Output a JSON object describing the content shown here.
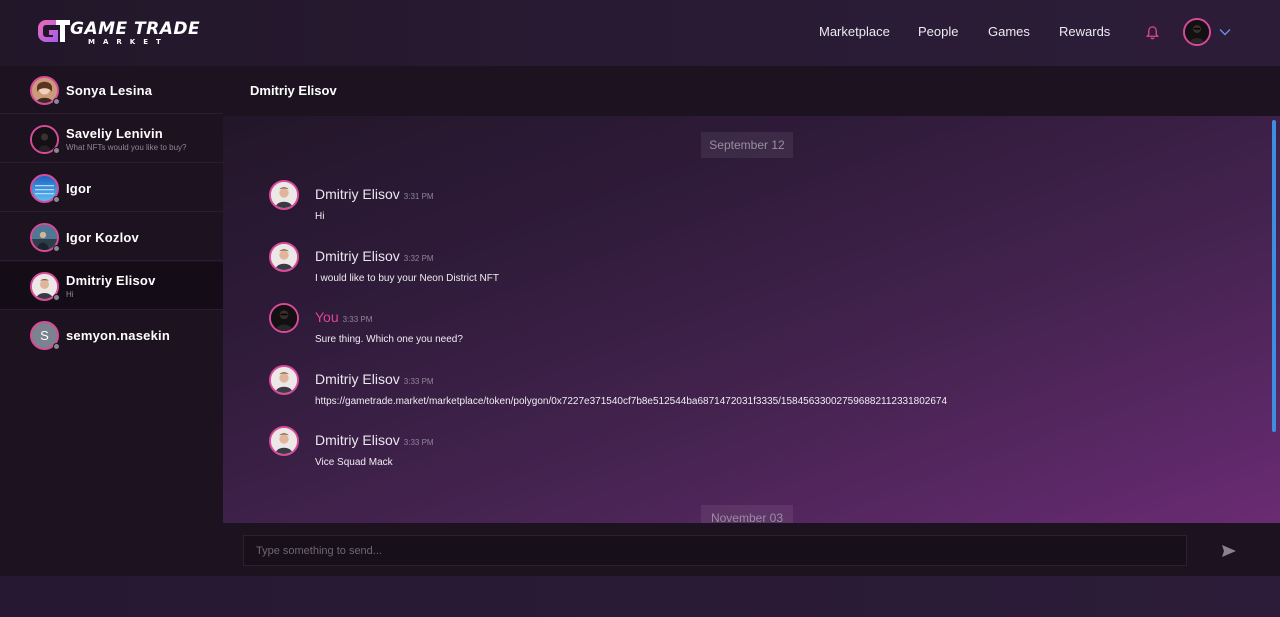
{
  "app": {
    "logo_main": "GAME TRADE",
    "logo_sub": "MARKET"
  },
  "nav": {
    "items": [
      "Marketplace",
      "People",
      "Games",
      "Rewards"
    ],
    "icons": {
      "bell": "bell-icon",
      "chevron": "chevron-down-icon"
    }
  },
  "colors": {
    "accent": "#d94a98",
    "you_name": "#e0449a",
    "scrollbar": "#3c8fe0",
    "sidebar_bg": "#1c1220"
  },
  "sidebar": {
    "contacts": [
      {
        "name": "Sonya Lesina",
        "preview": ""
      },
      {
        "name": "Saveliy Lenivin",
        "preview": "What NFTs would you like to buy?"
      },
      {
        "name": "Igor",
        "preview": ""
      },
      {
        "name": "Igor Kozlov",
        "preview": ""
      },
      {
        "name": "Dmitriy Elisov",
        "preview": "Hi",
        "active": true
      },
      {
        "name": "semyon.nasekin",
        "preview": "",
        "initial": "S"
      }
    ]
  },
  "chat": {
    "title": "Dmitriy Elisov",
    "dates": [
      "September 12",
      "November 03"
    ],
    "messages": [
      {
        "author": "Dmitriy Elisov",
        "time": "3:31 PM",
        "text": "Hi"
      },
      {
        "author": "Dmitriy Elisov",
        "time": "3:32 PM",
        "text": "I would like to buy your Neon District NFT"
      },
      {
        "author": "You",
        "time": "3:33 PM",
        "text": "Sure thing. Which one you need?"
      },
      {
        "author": "Dmitriy Elisov",
        "time": "3:33 PM",
        "text": "https://gametrade.market/marketplace/token/polygon/0x7227e371540cf7b8e512544ba6871472031f3335/158456330027596882112331802674"
      },
      {
        "author": "Dmitriy Elisov",
        "time": "3:33 PM",
        "text": "Vice Squad Mack"
      }
    ]
  },
  "composer": {
    "placeholder": "Type something to send...",
    "send_icon": "send-icon"
  }
}
